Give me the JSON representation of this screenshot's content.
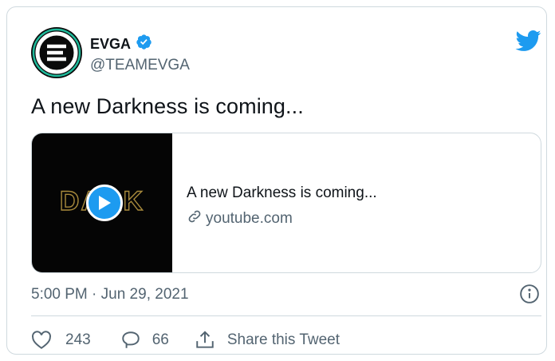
{
  "author": {
    "name": "EVGA",
    "handle": "@TEAMEVGA",
    "verified": true
  },
  "tweet": {
    "text": "A new Darkness is coming..."
  },
  "link_card": {
    "title": "A new Darkness is coming...",
    "domain": "youtube.com",
    "thumbnail_text": "DARK"
  },
  "meta": {
    "timestamp": "5:00 PM · Jun 29, 2021"
  },
  "actions": {
    "likes": "243",
    "replies": "66",
    "share_label": "Share this Tweet"
  },
  "colors": {
    "accent": "#1d9bf0",
    "text": "#0f1419",
    "muted": "#536471",
    "border": "#cfd9de"
  },
  "icons": [
    "verified-badge-icon",
    "twitter-bird-icon",
    "play-icon",
    "link-icon",
    "info-icon",
    "heart-icon",
    "reply-icon",
    "share-icon"
  ]
}
